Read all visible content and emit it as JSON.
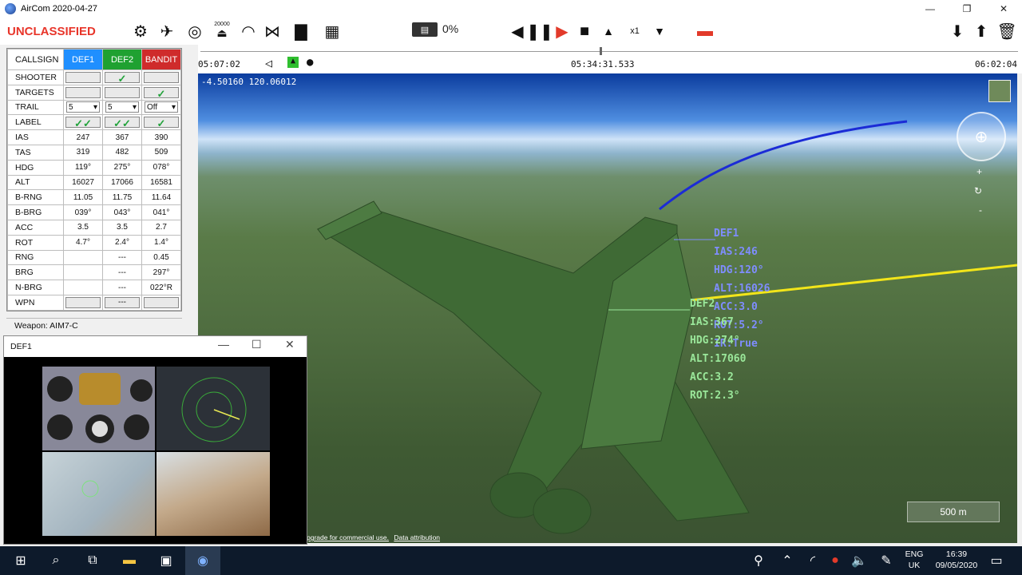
{
  "window": {
    "title": "AirCom 2020-04-27",
    "minimize": "—",
    "restore": "❐",
    "close": "✕"
  },
  "toolbar": {
    "classification": "UNCLASSIFIED",
    "altitude_badge": "20000",
    "progress_text": "0%",
    "speed_label": "x1"
  },
  "grid": {
    "header": {
      "label": "CALLSIGN",
      "col1": "DEF1",
      "col2": "DEF2",
      "col3": "BANDIT"
    },
    "rows": [
      {
        "label": "SHOOTER"
      },
      {
        "label": "TARGETS"
      },
      {
        "label": "TRAIL",
        "v1": "5",
        "v2": "5",
        "v3": "Off"
      },
      {
        "label": "LABEL"
      },
      {
        "label": "IAS",
        "v1": "247",
        "v2": "367",
        "v3": "390"
      },
      {
        "label": "TAS",
        "v1": "319",
        "v2": "482",
        "v3": "509"
      },
      {
        "label": "HDG",
        "v1": "119°",
        "v2": "275°",
        "v3": "078°"
      },
      {
        "label": "ALT",
        "v1": "16027",
        "v2": "17066",
        "v3": "16581"
      },
      {
        "label": "B-RNG",
        "v1": "11.05",
        "v2": "11.75",
        "v3": "11.64"
      },
      {
        "label": "B-BRG",
        "v1": "039°",
        "v2": "043°",
        "v3": "041°"
      },
      {
        "label": "ACC",
        "v1": "3.5",
        "v2": "3.5",
        "v3": "2.7"
      },
      {
        "label": "ROT",
        "v1": "4.7°",
        "v2": "2.4°",
        "v3": "1.4°"
      },
      {
        "label": "RNG",
        "v1": "",
        "v2": "---",
        "v3": "0.45"
      },
      {
        "label": "BRG",
        "v1": "",
        "v2": "---",
        "v3": "297°"
      },
      {
        "label": "N-BRG",
        "v1": "",
        "v2": "---",
        "v3": "022°R"
      },
      {
        "label": "WPN",
        "v1": "",
        "v2": "---",
        "v3": ""
      }
    ],
    "check": "✓"
  },
  "weapon_label": "Weapon: AIM7-C",
  "timeline": {
    "start": "05:07:02",
    "current": "05:34:31.533",
    "end": "06:02:04"
  },
  "view": {
    "coords": "-4.50160   120.06012",
    "scale": "500 m",
    "attribution_upgrade": "pgrade for commercial use.",
    "attribution_data": "Data attribution",
    "hud_def1": "DEF1\nIAS:246\nHDG:120°\nALT:16026\nACC:3.0\nROT:5.2°\nIR:True",
    "hud_def2": "DEF2\nIAS:367\nHDG:274°\nALT:17060\nACC:3.2\nROT:2.3°"
  },
  "subwindow": {
    "title": "DEF1"
  },
  "taskbar": {
    "lang_top": "ENG",
    "lang_bottom": "UK",
    "time": "16:39",
    "date": "09/05/2020"
  }
}
